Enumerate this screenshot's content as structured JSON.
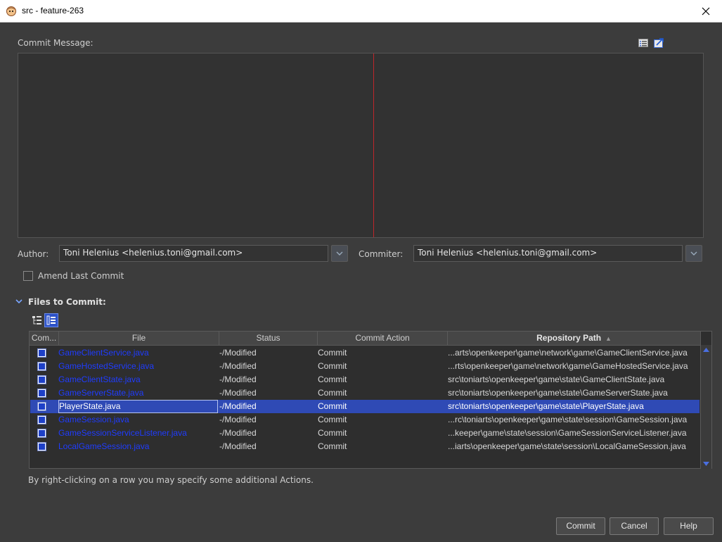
{
  "window": {
    "title": "src - feature-263"
  },
  "commit_message": {
    "label": "Commit Message:",
    "value": ""
  },
  "author": {
    "label": "Author:",
    "value": "Toni Helenius <helenius.toni@gmail.com>"
  },
  "committer": {
    "label": "Commiter:",
    "value": "Toni Helenius <helenius.toni@gmail.com>"
  },
  "amend": {
    "label": "Amend Last Commit",
    "checked": false
  },
  "files_section": {
    "label": "Files to Commit:"
  },
  "table": {
    "columns": [
      "Com...",
      "File",
      "Status",
      "Commit Action",
      "Repository Path"
    ],
    "sorted_column": "Repository Path",
    "rows": [
      {
        "file": "GameClientService.java",
        "status": "-/Modified",
        "action": "Commit",
        "path": "...arts\\openkeeper\\game\\network\\game\\GameClientService.java"
      },
      {
        "file": "GameHostedService.java",
        "status": "-/Modified",
        "action": "Commit",
        "path": "...rts\\openkeeper\\game\\network\\game\\GameHostedService.java"
      },
      {
        "file": "GameClientState.java",
        "status": "-/Modified",
        "action": "Commit",
        "path": "src\\toniarts\\openkeeper\\game\\state\\GameClientState.java"
      },
      {
        "file": "GameServerState.java",
        "status": "-/Modified",
        "action": "Commit",
        "path": "src\\toniarts\\openkeeper\\game\\state\\GameServerState.java"
      },
      {
        "file": "PlayerState.java",
        "status": "-/Modified",
        "action": "Commit",
        "path": "src\\toniarts\\openkeeper\\game\\state\\PlayerState.java"
      },
      {
        "file": "GameSession.java",
        "status": "-/Modified",
        "action": "Commit",
        "path": "...rc\\toniarts\\openkeeper\\game\\state\\session\\GameSession.java"
      },
      {
        "file": "GameSessionServiceListener.java",
        "status": "-/Modified",
        "action": "Commit",
        "path": "...keeper\\game\\state\\session\\GameSessionServiceListener.java"
      },
      {
        "file": "LocalGameSession.java",
        "status": "-/Modified",
        "action": "Commit",
        "path": "...iarts\\openkeeper\\game\\state\\session\\LocalGameSession.java"
      }
    ],
    "selected_row": 4
  },
  "hint": "By right-clicking on a row you may specify some additional Actions.",
  "buttons": {
    "commit": "Commit",
    "cancel": "Cancel",
    "help": "Help"
  },
  "colors": {
    "selection": "#2f4ab5",
    "link": "#1f3cff",
    "margin_line": "#c0262b"
  }
}
